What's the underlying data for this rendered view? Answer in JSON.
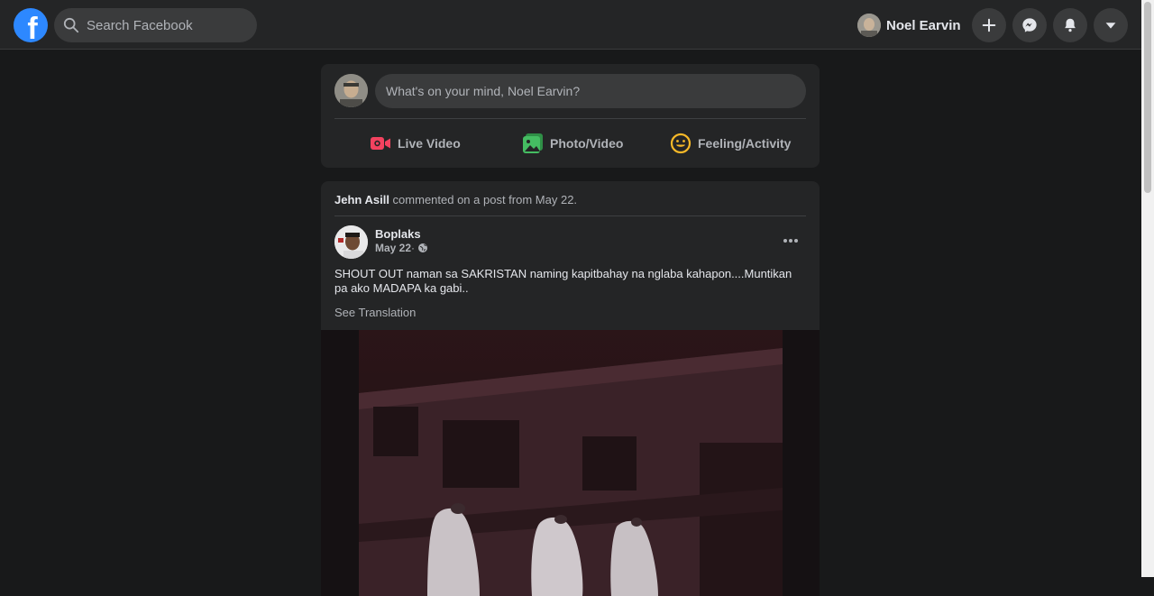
{
  "topbar": {
    "search_placeholder": "Search Facebook",
    "profile_name": "Noel Earvin"
  },
  "composer": {
    "prompt": "What's on your mind, Noel Earvin?",
    "actions": [
      {
        "label": "Live Video",
        "icon": "live-video-icon",
        "color": "#f3425f"
      },
      {
        "label": "Photo/Video",
        "icon": "photo-video-icon",
        "color": "#45bd62"
      },
      {
        "label": "Feeling/Activity",
        "icon": "feeling-icon",
        "color": "#f7b928"
      }
    ]
  },
  "post": {
    "activity_actor": "Jehn Asill",
    "activity_text": " commented on a post from May 22.",
    "author": "Boplaks",
    "date": "May 22",
    "separator": " ·",
    "text": "SHOUT OUT naman sa SAKRISTAN naming kapitbahay na nglaba kahapon....Muntikan pa ako MADAPA ka gabi..",
    "see_translation": "See Translation"
  },
  "colors": {
    "background": "#18191a",
    "surface": "#242526",
    "input": "#3a3b3c",
    "brand": "#2d88ff"
  }
}
